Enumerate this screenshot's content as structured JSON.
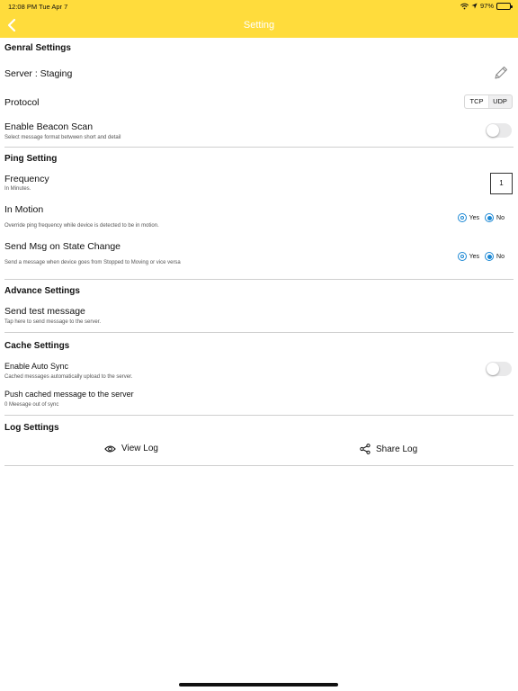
{
  "statusbar": {
    "time": "12:08 PM   Tue Apr 7",
    "battery": "97%",
    "battery_level": 0.97
  },
  "nav": {
    "title": "Setting"
  },
  "general": {
    "header": "Genral Settings",
    "server_label": "Server : Staging",
    "protocol_label": "Protocol",
    "protocol_options": [
      "TCP",
      "UDP"
    ],
    "protocol_selected": "TCP",
    "beacon_title": "Enable Beacon Scan",
    "beacon_sub": "Select message format betwwen short and detail"
  },
  "ping": {
    "header": "Ping Setting",
    "frequency_title": "Frequency",
    "frequency_sub": "In Minutes.",
    "frequency_value": "1",
    "motion_title": "In Motion",
    "motion_sub": "Override ping frequency while device is detected to be in motion.",
    "state_title": "Send Msg on State Change",
    "state_sub": "Send a message when device goes from Stopped to Moving or vice versa",
    "yes_label": "Yes",
    "no_label": "No"
  },
  "advance": {
    "header": "Advance Settings",
    "test_title": "Send test message",
    "test_sub": "Tap here to send message to the server."
  },
  "cache": {
    "header": "Cache Settings",
    "autosync_title": "Enable Auto Sync",
    "autosync_sub": "Cached messages automatically upload to the server.",
    "push_title": "Push cached message to the server",
    "push_sub": "0 Meesage out of sync"
  },
  "log": {
    "header": "Log Settings",
    "view_label": "View Log",
    "share_label": "Share Log"
  },
  "colors": {
    "accent": "#FFDC3C",
    "radio": "#1a87d4"
  }
}
